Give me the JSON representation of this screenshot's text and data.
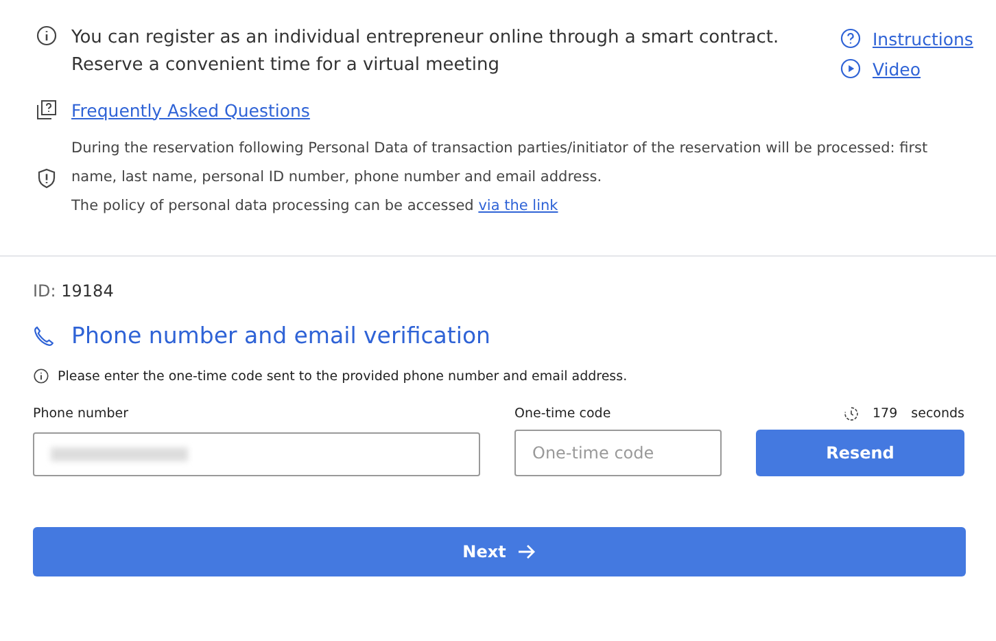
{
  "info": {
    "text": "You can register as an individual entrepreneur online through a smart contract. Reserve a convenient time for a virtual meeting"
  },
  "links": [
    {
      "kind": "help",
      "label": "Instructions"
    },
    {
      "kind": "video",
      "label": "Video"
    }
  ],
  "faq": {
    "label": "Frequently Asked Questions"
  },
  "privacy": {
    "text": "During the reservation following Personal Data of transaction parties/initiator of the reservation will be processed: first name, last name, personal ID number, phone number and email address.",
    "policy": "The policy of personal data processing can be accessed",
    "link": "via the link"
  },
  "id": {
    "label": "ID:",
    "value": "19184"
  },
  "section": {
    "title": "Phone number and email verification",
    "hint": "Please enter the one-time code sent to the provided phone number and email address."
  },
  "phone": {
    "label": "Phone number",
    "value_redacted": true
  },
  "code": {
    "label": "One-time code",
    "placeholder": "One-time code"
  },
  "timer": {
    "value": "179",
    "unit": "seconds"
  },
  "resend": {
    "label": "Resend"
  },
  "next": {
    "label": "Next"
  }
}
